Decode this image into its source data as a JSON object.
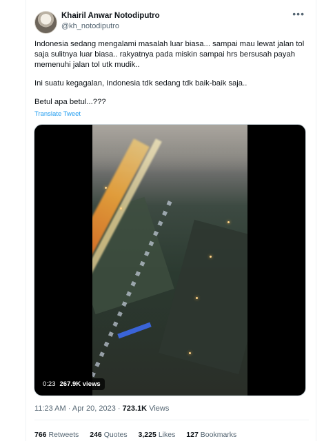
{
  "tweet": {
    "author_name": "Khairil Anwar Notodiputro",
    "author_handle": "@kh_notodiputro",
    "more_icon": "more-dots-icon",
    "paragraphs": [
      "Indonesia sedang mengalami masalah luar biasa... sampai mau lewat jalan tol saja sulitnya luar biasa.. rakyatnya pada miskin sampai hrs bersusah payah memenuhi jalan tol utk mudik..",
      "Ini suatu kegagalan, Indonesia tdk sedang tdk baik-baik saja..",
      "Betul apa betul...???"
    ],
    "translate_label": "Translate Tweet",
    "video": {
      "duration": "0:23",
      "views": "267.9K views"
    },
    "time": "11:23 AM",
    "separator": "·",
    "date": "Apr 20, 2023",
    "view_count": "723.1K",
    "view_label": "Views"
  },
  "stats": [
    {
      "count": "766",
      "label": "Retweets"
    },
    {
      "count": "246",
      "label": "Quotes"
    },
    {
      "count": "3,225",
      "label": "Likes"
    },
    {
      "count": "127",
      "label": "Bookmarks"
    }
  ],
  "colors": {
    "link": "#1d9bf0",
    "secondary_text": "#536471",
    "primary_text": "#0f1419"
  }
}
